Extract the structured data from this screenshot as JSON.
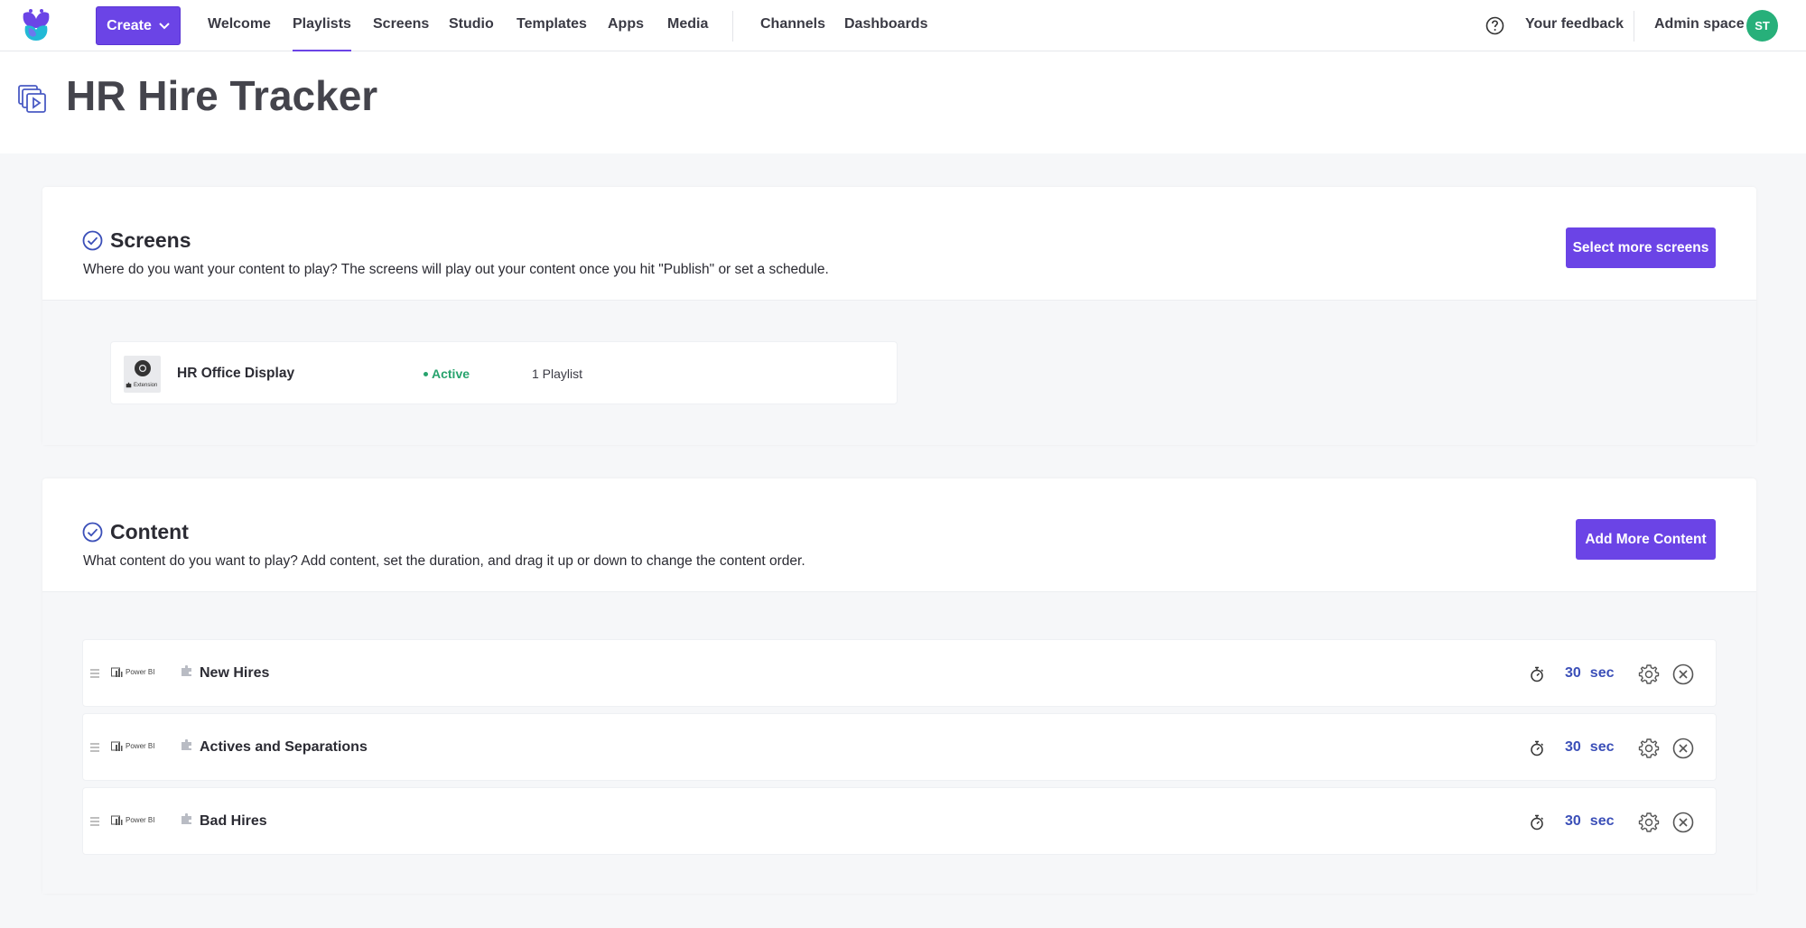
{
  "nav": {
    "create_label": "Create",
    "items": [
      "Welcome",
      "Playlists",
      "Screens",
      "Studio",
      "Templates",
      "Apps",
      "Media",
      "Channels",
      "Dashboards"
    ],
    "active": "Playlists",
    "feedback_label": "Your feedback",
    "space_label": "Admin space",
    "avatar_initials": "ST"
  },
  "page": {
    "title": "HR Hire Tracker"
  },
  "screens_section": {
    "title": "Screens",
    "description": "Where do you want your content to play? The screens will play out your content once you hit \"Publish\" or set a schedule.",
    "button_label": "Select more screens",
    "items": [
      {
        "name": "HR Office Display",
        "status": "Active",
        "playlists": "1 Playlist",
        "thumb_label": "Extension"
      }
    ]
  },
  "content_section": {
    "title": "Content",
    "description": "What content do you want to play? Add content, set the duration, and drag it up or down to change the content order.",
    "button_label": "Add More Content",
    "source_label": "Power BI",
    "duration_unit": "sec",
    "items": [
      {
        "name": "New Hires",
        "duration": "30"
      },
      {
        "name": "Actives and Separations",
        "duration": "30"
      },
      {
        "name": "Bad Hires",
        "duration": "30"
      }
    ]
  },
  "colors": {
    "accent": "#6b44e6",
    "status_active": "#27a36d",
    "duration": "#3b4fb8",
    "avatar": "#27b07a"
  }
}
